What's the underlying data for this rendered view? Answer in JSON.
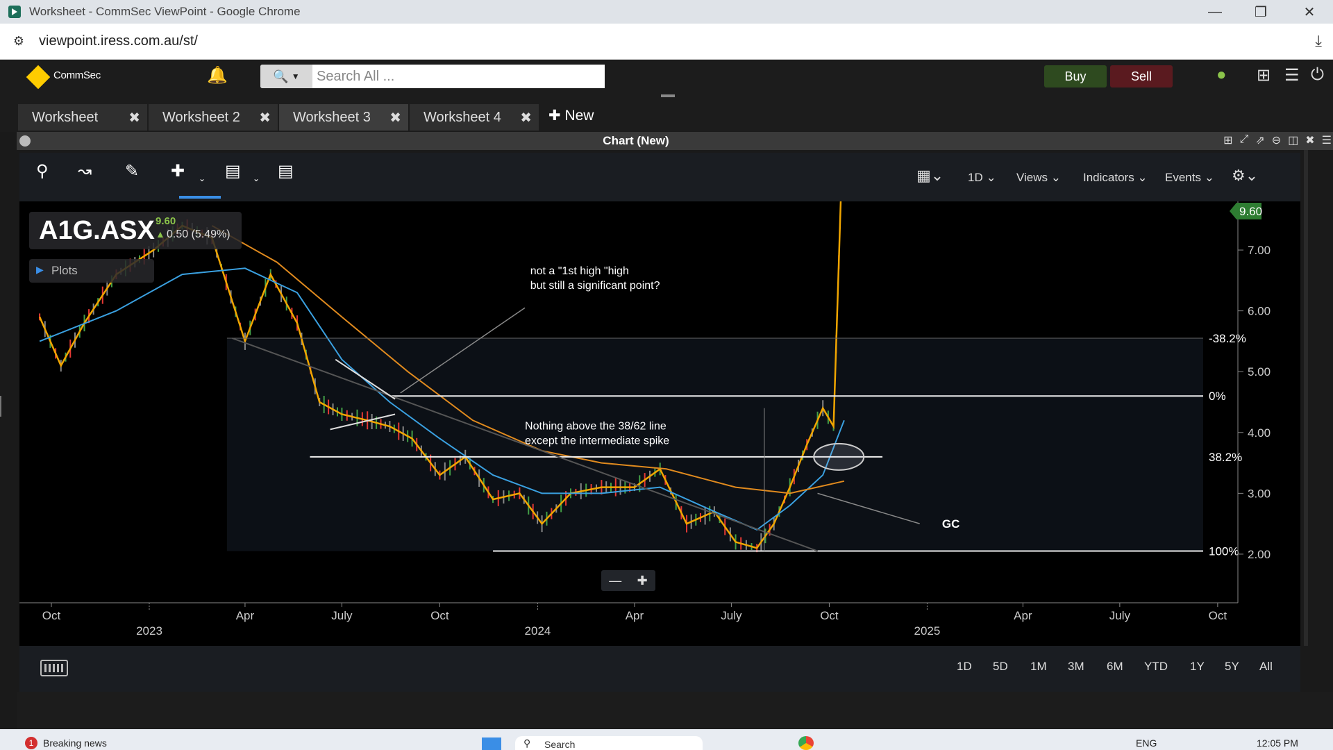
{
  "browser": {
    "window_title": "Worksheet - CommSec ViewPoint - Google Chrome",
    "url": "viewpoint.iress.com.au/st/"
  },
  "header": {
    "brand": "CommSec",
    "search_placeholder": "Search All ...",
    "buy_label": "Buy",
    "sell_label": "Sell"
  },
  "tabs": [
    {
      "label": "Worksheet"
    },
    {
      "label": "Worksheet 2"
    },
    {
      "label": "Worksheet 3"
    },
    {
      "label": "Worksheet 4"
    }
  ],
  "new_tab_label": "New",
  "panel": {
    "title": "Chart (New)"
  },
  "toolbar": {
    "interval": "1D",
    "views": "Views",
    "indicators": "Indicators",
    "events": "Events"
  },
  "symbol": {
    "code": "A1G.ASX",
    "price": "9.60",
    "change": "0.50 (5.49%)",
    "plots_label": "Plots"
  },
  "chart_data": {
    "type": "line",
    "symbol": "A1G.ASX",
    "last_price": 9.6,
    "last_price_label": "9.60",
    "y_ticks": [
      "2.00",
      "3.00",
      "4.00",
      "5.00",
      "6.00",
      "7.00"
    ],
    "ylim": [
      1.2,
      7.8
    ],
    "x_month_ticks": [
      "Oct",
      "Apr",
      "July",
      "Oct",
      "Apr",
      "July",
      "Oct",
      "Apr",
      "July",
      "Oct"
    ],
    "x_year_ticks": [
      "2023",
      "2024",
      "2025"
    ],
    "series": [
      {
        "color": "#f0a500",
        "x": [
          "2022-09-20",
          "2022-10-10",
          "2022-11-01",
          "2022-12-01",
          "2023-01-05",
          "2023-02-01",
          "2023-03-01",
          "2023-04-01",
          "2023-04-25",
          "2023-05-20",
          "2023-06-10",
          "2023-07-01",
          "2023-07-25",
          "2023-08-15",
          "2023-09-05",
          "2023-10-01",
          "2023-10-25",
          "2023-11-20",
          "2023-12-15",
          "2024-01-05",
          "2024-02-01",
          "2024-03-01",
          "2024-04-01",
          "2024-04-25",
          "2024-05-20",
          "2024-06-15",
          "2024-07-05",
          "2024-07-25",
          "2024-08-10",
          "2024-08-25",
          "2024-09-10",
          "2024-09-25",
          "2024-10-05",
          "2024-10-10",
          "2024-10-15"
        ],
        "values": [
          5.9,
          5.1,
          5.8,
          6.6,
          7.0,
          7.4,
          7.2,
          5.5,
          6.6,
          5.8,
          4.5,
          4.3,
          4.2,
          4.1,
          3.9,
          3.3,
          3.6,
          2.9,
          3.0,
          2.5,
          3.0,
          3.1,
          3.1,
          3.4,
          2.5,
          2.7,
          2.2,
          2.1,
          2.5,
          3.1,
          3.8,
          4.4,
          4.1,
          6.8,
          9.6
        ]
      },
      {
        "color": "#3aa0e0",
        "x": [
          "2022-09-20",
          "2022-12-01",
          "2023-02-01",
          "2023-04-01",
          "2023-05-20",
          "2023-07-01",
          "2023-08-15",
          "2023-10-01",
          "2023-11-20",
          "2024-01-05",
          "2024-03-01",
          "2024-04-25",
          "2024-06-15",
          "2024-07-25",
          "2024-08-25",
          "2024-09-25",
          "2024-10-15"
        ],
        "values": [
          5.5,
          6.0,
          6.6,
          6.7,
          6.3,
          5.2,
          4.5,
          3.9,
          3.3,
          3.0,
          3.0,
          3.1,
          2.7,
          2.4,
          2.8,
          3.3,
          4.2
        ]
      },
      {
        "color": "#e08a1e",
        "x": [
          "2023-03-01",
          "2023-05-01",
          "2023-07-01",
          "2023-09-01",
          "2023-11-01",
          "2024-01-05",
          "2024-03-01",
          "2024-05-01",
          "2024-07-05",
          "2024-08-25",
          "2024-10-15"
        ],
        "values": [
          7.4,
          6.8,
          5.9,
          5.0,
          4.2,
          3.7,
          3.5,
          3.4,
          3.1,
          3.0,
          3.2
        ]
      }
    ],
    "fib_levels": [
      {
        "label": "-38.2%",
        "value": 5.55
      },
      {
        "label": "0%",
        "value": 4.6
      },
      {
        "label": "38.2%",
        "value": 3.6
      },
      {
        "label": "100%",
        "value": 2.05
      }
    ],
    "annotations": [
      {
        "text": "not a \"1st high \"high",
        "text2": "but still a significant point?"
      },
      {
        "text": "Nothing above the 38/62 line",
        "text2": "except the intermediate spike"
      },
      {
        "text": "GC"
      }
    ]
  },
  "ranges": [
    "1D",
    "5D",
    "1M",
    "3M",
    "6M",
    "YTD",
    "1Y",
    "5Y",
    "All"
  ],
  "taskbar": {
    "news": "Breaking news",
    "badge": "1",
    "search": "Search",
    "lang": "ENG",
    "time": "12:05 PM"
  }
}
